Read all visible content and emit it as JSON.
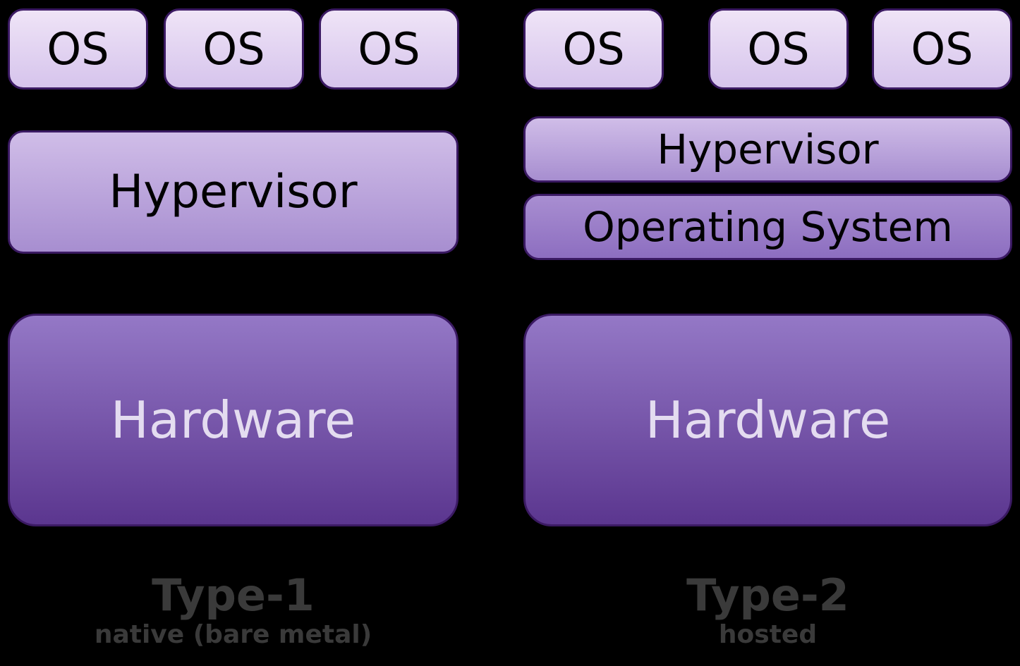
{
  "type1": {
    "os": [
      "OS",
      "OS",
      "OS"
    ],
    "hypervisor": "Hypervisor",
    "hardware": "Hardware",
    "title": "Type-1",
    "subtitle": "native (bare metal)"
  },
  "type2": {
    "os": [
      "OS",
      "OS",
      "OS"
    ],
    "hypervisor": "Hypervisor",
    "operating_system": "Operating System",
    "hardware": "Hardware",
    "title": "Type-2",
    "subtitle": "hosted"
  }
}
